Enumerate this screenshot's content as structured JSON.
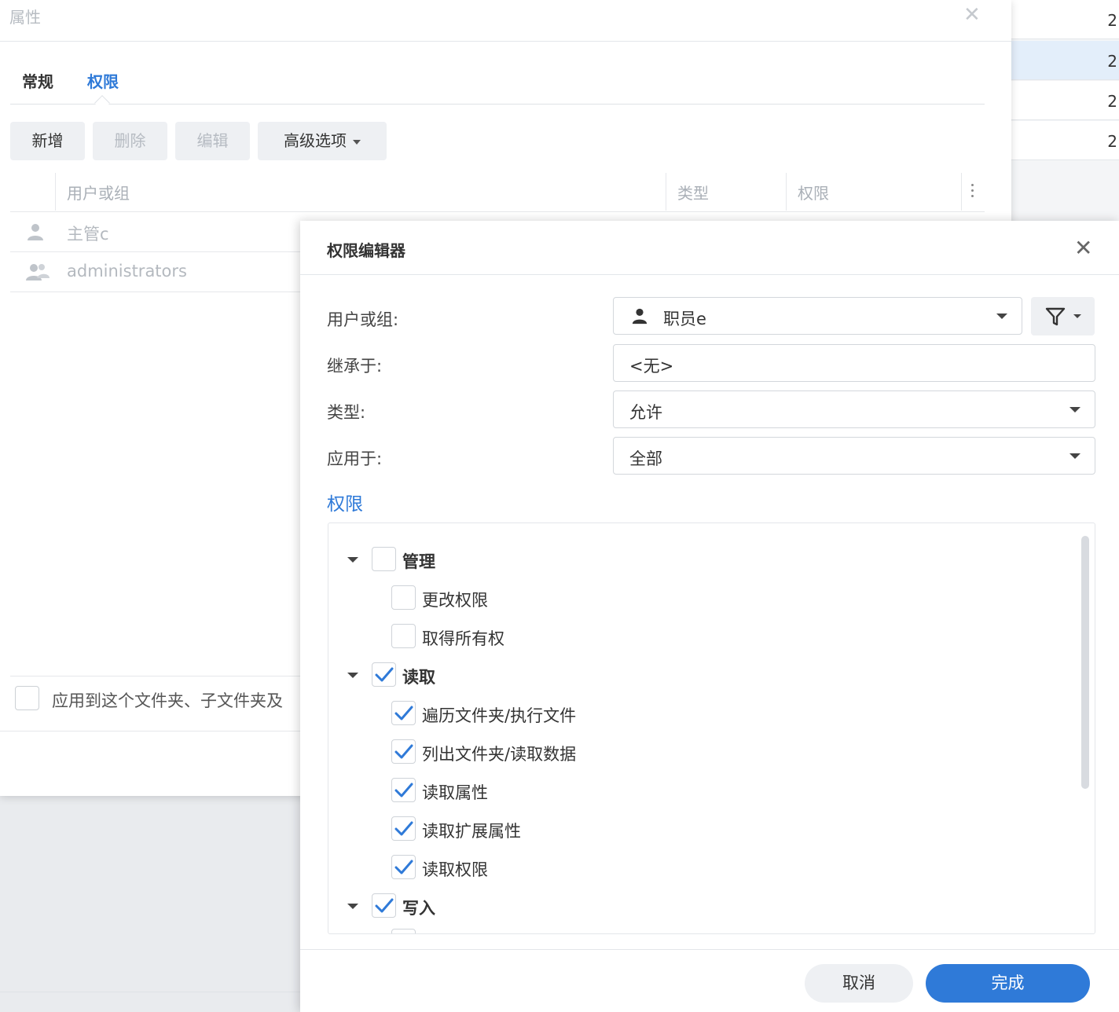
{
  "background_list": {
    "rows": [
      "2",
      "2",
      "2",
      "2"
    ]
  },
  "properties": {
    "title": "属性",
    "tabs": [
      {
        "label": "常规"
      },
      {
        "label": "权限"
      }
    ],
    "toolbar": {
      "add": "新增",
      "delete": "删除",
      "edit": "编辑",
      "advanced": "高级选项"
    },
    "table": {
      "headers": {
        "user_or_group": "用户或组",
        "type": "类型",
        "permission": "权限"
      },
      "rows": [
        {
          "name": "主管c",
          "icon": "user-icon"
        },
        {
          "name": "administrators",
          "icon": "group-icon"
        }
      ]
    },
    "apply_label": "应用到这个文件夹、子文件夹及"
  },
  "editor": {
    "title": "权限编辑器",
    "fields": {
      "user_label": "用户或组:",
      "user_value": "职员e",
      "inherit_label": "继承于:",
      "inherit_value": "<无>",
      "type_label": "类型:",
      "type_value": "允许",
      "apply_label": "应用于:",
      "apply_value": "全部"
    },
    "permission_heading": "权限",
    "tree": {
      "manage": {
        "label": "管理",
        "checked": false,
        "children": [
          "更改权限",
          "取得所有权"
        ]
      },
      "read": {
        "label": "读取",
        "checked": true,
        "children": [
          "遍历文件夹/执行文件",
          "列出文件夹/读取数据",
          "读取属性",
          "读取扩展属性",
          "读取权限"
        ]
      },
      "write": {
        "label": "写入",
        "checked": true
      }
    },
    "buttons": {
      "cancel": "取消",
      "done": "完成"
    },
    "colors": {
      "accent": "#2f7ad8"
    }
  }
}
